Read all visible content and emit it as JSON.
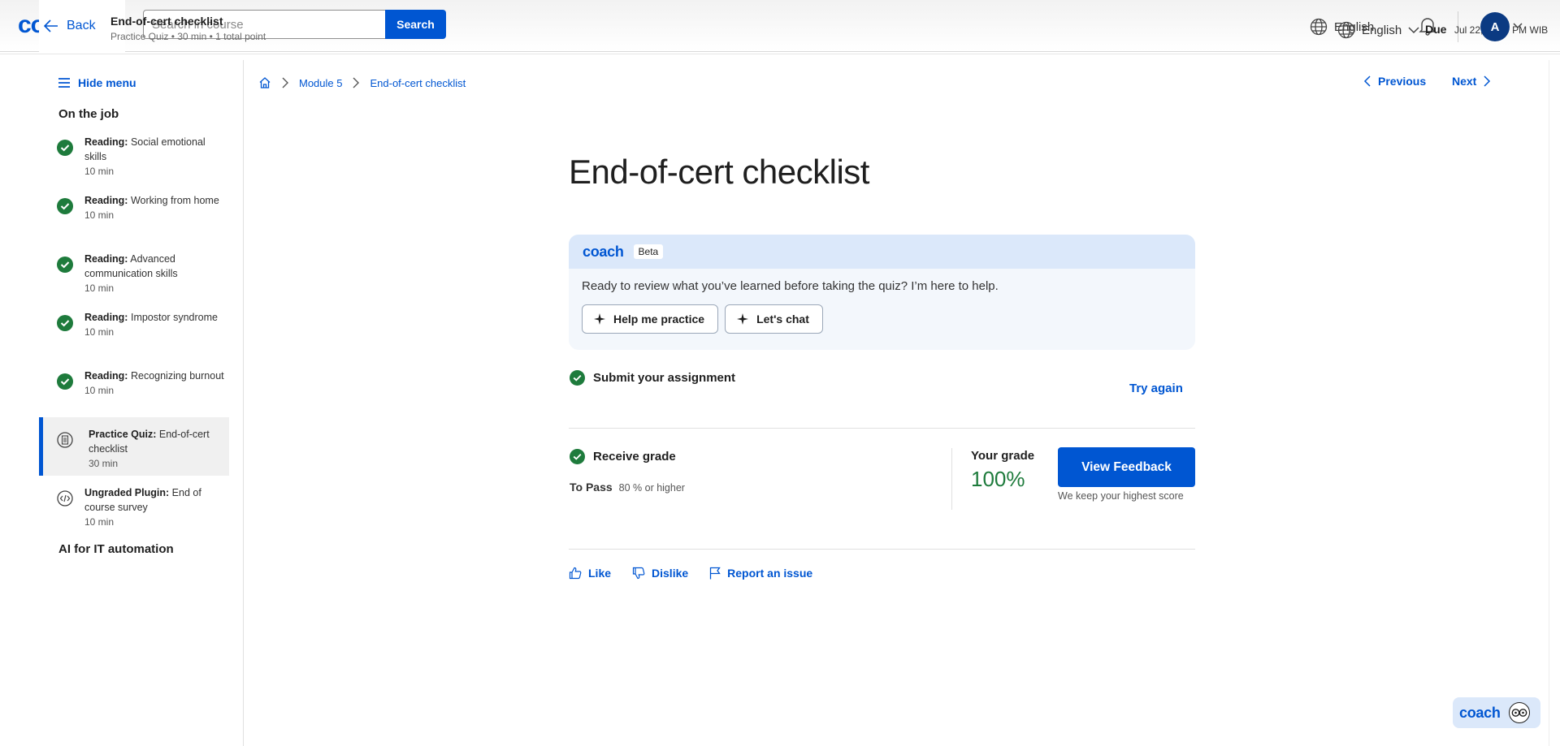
{
  "header": {
    "logo_text": "coursera",
    "back_label": "Back",
    "course_title": "End-of-cert checklist",
    "course_subtitle": "Practice Quiz • 30 min • 1 total point",
    "search_placeholder": "Search in course",
    "search_button": "Search",
    "language_primary": "English",
    "language_secondary": "English",
    "due_label": "Due",
    "due_date": "Jul 22, 11:59 PM WIB",
    "avatar_initial": "A"
  },
  "sidebar": {
    "hide_menu": "Hide menu",
    "section_title": "On the job",
    "items": [
      {
        "type": "Reading:",
        "title": "Social emotional skills",
        "duration": "10 min"
      },
      {
        "type": "Reading:",
        "title": "Working from home",
        "duration": "10 min"
      },
      {
        "type": "Reading:",
        "title": "Advanced communication skills",
        "duration": "10 min"
      },
      {
        "type": "Reading:",
        "title": "Impostor syndrome",
        "duration": "10 min"
      },
      {
        "type": "Reading:",
        "title": "Recognizing burnout",
        "duration": "10 min"
      },
      {
        "type": "Practice Quiz:",
        "title": "End-of-cert checklist",
        "duration": "30 min"
      },
      {
        "type": "Ungraded Plugin:",
        "title": "End of course survey",
        "duration": "10 min"
      }
    ],
    "next_section": "AI for IT automation"
  },
  "breadcrumb": {
    "module": "Module 5",
    "current": "End-of-cert checklist"
  },
  "nav": {
    "previous": "Previous",
    "next": "Next"
  },
  "main": {
    "title": "End-of-cert checklist",
    "coach": {
      "logo": "coach",
      "badge": "Beta",
      "message": "Ready to review what you’ve learned before taking the quiz? I’m here to help.",
      "btn_practice": "Help me practice",
      "btn_chat": "Let's chat"
    },
    "submit_label": "Submit your assignment",
    "try_again": "Try again",
    "receive_grade": "Receive grade",
    "to_pass_label": "To Pass",
    "to_pass_value": "80 % or higher",
    "your_grade_label": "Your grade",
    "your_grade_value": "100%",
    "view_feedback": "View Feedback",
    "highest_score_note": "We keep your highest score",
    "like": "Like",
    "dislike": "Dislike",
    "report": "Report an issue"
  },
  "floating_coach": "coach",
  "colors": {
    "brand": "#0056d2",
    "success": "#1e7b3c",
    "coach_bg": "#dbe8fa"
  }
}
